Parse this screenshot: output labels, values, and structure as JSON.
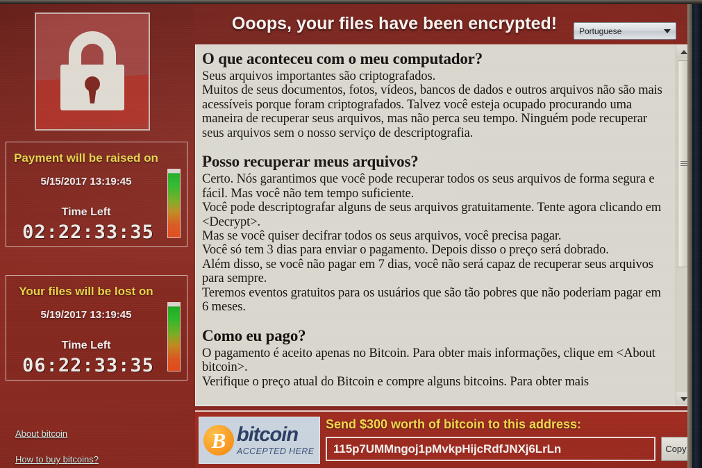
{
  "header": {
    "title": "Ooops, your files have been encrypted!",
    "language_selected": "Portuguese"
  },
  "lock_icon": {
    "name": "padlock-icon"
  },
  "countdowns": [
    {
      "title": "Payment will be raised on",
      "date": "5/15/2017 13:19:45",
      "time_left_label": "Time Left",
      "digits": "02:22:33:35"
    },
    {
      "title": "Your files will be lost on",
      "date": "5/19/2017 13:19:45",
      "time_left_label": "Time Left",
      "digits": "06:22:33:35"
    }
  ],
  "links": {
    "about_bitcoin": "About bitcoin",
    "how_to_buy": "How to buy bitcoins?"
  },
  "body": {
    "section1_heading": "O que aconteceu com o meu computador?",
    "section1_p1": "Seus arquivos importantes são criptografados.",
    "section1_p2": "Muitos de seus documentos, fotos, vídeos, bancos de dados e outros arquivos não são mais acessíveis porque foram criptografados. Talvez você esteja ocupado procurando uma maneira de recuperar seus arquivos, mas não perca seu tempo. Ninguém pode recuperar seus arquivos sem o nosso serviço de descriptografia.",
    "section2_heading": "Posso recuperar meus arquivos?",
    "section2_p1": "Certo. Nós garantimos que você pode recuperar todos os seus arquivos de forma segura e fácil. Mas você não tem tempo suficiente.",
    "section2_p2": "Você pode descriptografar alguns de seus arquivos gratuitamente. Tente agora clicando em <Decrypt>.",
    "section2_p3": "Mas se você quiser decifrar todos os seus arquivos, você precisa pagar.",
    "section2_p4": "Você só tem 3 dias para enviar o pagamento. Depois disso o preço será dobrado.",
    "section2_p5": "Além disso, se você não pagar em 7 dias, você não será capaz de recuperar seus arquivos para sempre.",
    "section2_p6": "Teremos eventos gratuitos para os usuários que são tão pobres que não poderiam pagar em 6 meses.",
    "section3_heading": "Como eu pago?",
    "section3_p1": "O pagamento é aceito apenas no Bitcoin. Para obter mais informações, clique em <About bitcoin>.",
    "section3_p2": "Verifique o preço atual do Bitcoin e compre alguns bitcoins. Para obter mais"
  },
  "bottom": {
    "bitcoin_logo_mark": "B",
    "bitcoin_logo_name": "bitcoin",
    "bitcoin_logo_sub": "ACCEPTED HERE",
    "send_label": "Send $300 worth of bitcoin to this address:",
    "address": "115p7UMMngoj1pMvkpHijcRdfJNXj6LrLn",
    "copy_label": "Copy"
  },
  "colors": {
    "window_red": "#8a2a22",
    "accent_yellow": "#efd84b",
    "text_panel": "#d9d7cd",
    "link_color": "#cfe9e4",
    "gauge_top": "#2bb82b",
    "gauge_bottom": "#e0491c"
  }
}
